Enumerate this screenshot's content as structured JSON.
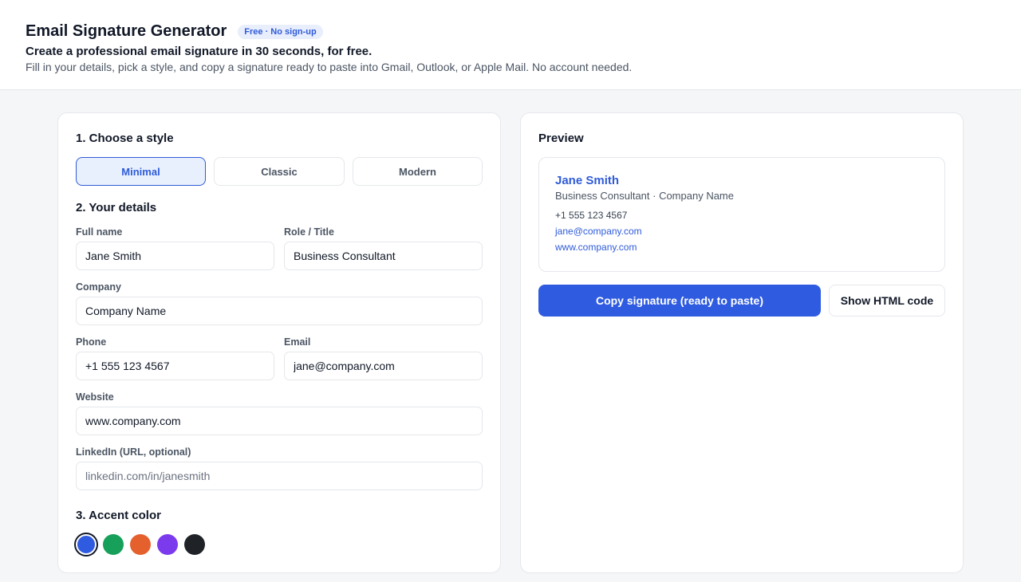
{
  "header": {
    "title": "Email Signature Generator",
    "badge": "Free · No sign-up",
    "subtitle": "Create a professional email signature in 30 seconds, for free.",
    "description": "Fill in your details, pick a style, and copy a signature ready to paste into Gmail, Outlook, or Apple Mail. No account needed."
  },
  "form": {
    "style_section": "1. Choose a style",
    "styles": [
      {
        "label": "Minimal",
        "selected": true
      },
      {
        "label": "Classic",
        "selected": false
      },
      {
        "label": "Modern",
        "selected": false
      }
    ],
    "details_section": "2. Your details",
    "fields": {
      "full_name": {
        "label": "Full name",
        "value": "Jane Smith"
      },
      "role": {
        "label": "Role / Title",
        "value": "Business Consultant"
      },
      "company": {
        "label": "Company",
        "value": "Company Name"
      },
      "phone": {
        "label": "Phone",
        "value": "+1 555 123 4567"
      },
      "email": {
        "label": "Email",
        "value": "jane@company.com"
      },
      "website": {
        "label": "Website",
        "value": "www.company.com"
      },
      "linkedin": {
        "label": "LinkedIn (URL, optional)",
        "value": "",
        "placeholder": "linkedin.com/in/janesmith"
      }
    },
    "accent_section": "3. Accent color",
    "accent_colors": [
      {
        "name": "blue",
        "hex": "#2f5be0",
        "selected": true
      },
      {
        "name": "green",
        "hex": "#16a05a",
        "selected": false
      },
      {
        "name": "orange",
        "hex": "#e4602d",
        "selected": false
      },
      {
        "name": "purple",
        "hex": "#7c3aed",
        "selected": false
      },
      {
        "name": "black",
        "hex": "#1f2328",
        "selected": false
      }
    ]
  },
  "preview": {
    "title": "Preview",
    "signature": {
      "name": "Jane Smith",
      "role_line": "Business Consultant · Company Name",
      "phone": "+1 555 123 4567",
      "email": "jane@company.com",
      "website": "www.company.com"
    },
    "copy_button": "Copy signature (ready to paste)",
    "html_button": "Show HTML code"
  }
}
